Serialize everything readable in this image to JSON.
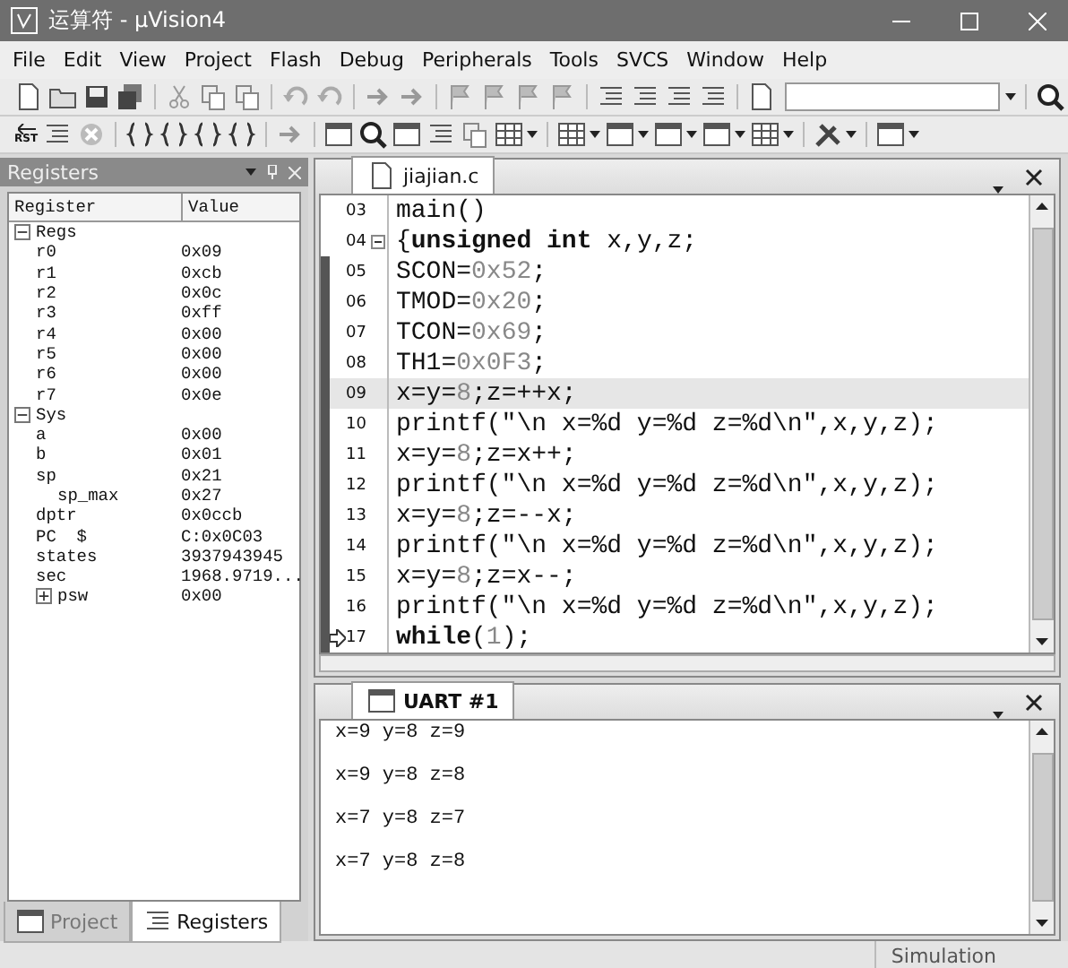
{
  "window": {
    "title": "运算符 - μVision4"
  },
  "menu": [
    "File",
    "Edit",
    "View",
    "Project",
    "Flash",
    "Debug",
    "Peripherals",
    "Tools",
    "SVCS",
    "Window",
    "Help"
  ],
  "debug_toolbar": {
    "reset_label": "RST"
  },
  "registers_panel": {
    "title": "Registers",
    "columns": [
      "Register",
      "Value"
    ],
    "tree": [
      {
        "name": "Regs",
        "expanded": true,
        "children": [
          {
            "name": "r0",
            "value": "0x09"
          },
          {
            "name": "r1",
            "value": "0xcb"
          },
          {
            "name": "r2",
            "value": "0x0c"
          },
          {
            "name": "r3",
            "value": "0xff"
          },
          {
            "name": "r4",
            "value": "0x00"
          },
          {
            "name": "r5",
            "value": "0x00"
          },
          {
            "name": "r6",
            "value": "0x00"
          },
          {
            "name": "r7",
            "value": "0x0e"
          }
        ]
      },
      {
        "name": "Sys",
        "expanded": true,
        "children": [
          {
            "name": "a",
            "value": "0x00"
          },
          {
            "name": "b",
            "value": "0x01"
          },
          {
            "name": "sp",
            "value": "0x21",
            "children": [
              {
                "name": "sp_max",
                "value": "0x27"
              }
            ]
          },
          {
            "name": "dptr",
            "value": "0x0ccb"
          },
          {
            "name": "PC  $",
            "value": "C:0x0C03"
          },
          {
            "name": "states",
            "value": "3937943945"
          },
          {
            "name": "sec",
            "value": "1968.9719..."
          },
          {
            "name": "psw",
            "value": "0x00",
            "expanded": false
          }
        ]
      }
    ],
    "tabs": [
      {
        "label": "Project",
        "selected": false
      },
      {
        "label": "Registers",
        "selected": true
      }
    ]
  },
  "editor": {
    "tab": "jiajian.c",
    "lines": [
      {
        "number": "03",
        "fold": false,
        "marked": false,
        "current": false,
        "pc": false,
        "segments": [
          {
            "text": "main()",
            "kind": "text"
          }
        ]
      },
      {
        "number": "04",
        "fold": true,
        "marked": false,
        "current": false,
        "pc": false,
        "segments": [
          {
            "text": "{",
            "kind": "text"
          },
          {
            "text": "unsigned int",
            "kind": "keyword"
          },
          {
            "text": " x,y,z;",
            "kind": "text"
          }
        ]
      },
      {
        "number": "05",
        "fold": false,
        "marked": true,
        "current": false,
        "pc": false,
        "segments": [
          {
            "text": "SCON=",
            "kind": "text"
          },
          {
            "text": "0x52",
            "kind": "number"
          },
          {
            "text": ";",
            "kind": "text"
          }
        ]
      },
      {
        "number": "06",
        "fold": false,
        "marked": true,
        "current": false,
        "pc": false,
        "segments": [
          {
            "text": "TMOD=",
            "kind": "text"
          },
          {
            "text": "0x20",
            "kind": "number"
          },
          {
            "text": ";",
            "kind": "text"
          }
        ]
      },
      {
        "number": "07",
        "fold": false,
        "marked": true,
        "current": false,
        "pc": false,
        "segments": [
          {
            "text": "TCON=",
            "kind": "text"
          },
          {
            "text": "0x69",
            "kind": "number"
          },
          {
            "text": ";",
            "kind": "text"
          }
        ]
      },
      {
        "number": "08",
        "fold": false,
        "marked": true,
        "current": false,
        "pc": false,
        "segments": [
          {
            "text": "TH1=",
            "kind": "text"
          },
          {
            "text": "0x0F3",
            "kind": "number"
          },
          {
            "text": ";",
            "kind": "text"
          }
        ]
      },
      {
        "number": "09",
        "fold": false,
        "marked": true,
        "current": true,
        "pc": false,
        "segments": [
          {
            "text": "x=y=",
            "kind": "text"
          },
          {
            "text": "8",
            "kind": "number"
          },
          {
            "text": ";z=++x;",
            "kind": "text"
          }
        ]
      },
      {
        "number": "10",
        "fold": false,
        "marked": true,
        "current": false,
        "pc": false,
        "segments": [
          {
            "text": "printf(\"\\n x=%d y=%d z=%d\\n\",x,y,z);",
            "kind": "text"
          }
        ]
      },
      {
        "number": "11",
        "fold": false,
        "marked": true,
        "current": false,
        "pc": false,
        "segments": [
          {
            "text": "x=y=",
            "kind": "text"
          },
          {
            "text": "8",
            "kind": "number"
          },
          {
            "text": ";z=x++;",
            "kind": "text"
          }
        ]
      },
      {
        "number": "12",
        "fold": false,
        "marked": true,
        "current": false,
        "pc": false,
        "segments": [
          {
            "text": "printf(\"\\n x=%d y=%d z=%d\\n\",x,y,z);",
            "kind": "text"
          }
        ]
      },
      {
        "number": "13",
        "fold": false,
        "marked": true,
        "current": false,
        "pc": false,
        "segments": [
          {
            "text": "x=y=",
            "kind": "text"
          },
          {
            "text": "8",
            "kind": "number"
          },
          {
            "text": ";z=--x;",
            "kind": "text"
          }
        ]
      },
      {
        "number": "14",
        "fold": false,
        "marked": true,
        "current": false,
        "pc": false,
        "segments": [
          {
            "text": "printf(\"\\n x=%d y=%d z=%d\\n\",x,y,z);",
            "kind": "text"
          }
        ]
      },
      {
        "number": "15",
        "fold": false,
        "marked": true,
        "current": false,
        "pc": false,
        "segments": [
          {
            "text": "x=y=",
            "kind": "text"
          },
          {
            "text": "8",
            "kind": "number"
          },
          {
            "text": ";z=x--;",
            "kind": "text"
          }
        ]
      },
      {
        "number": "16",
        "fold": false,
        "marked": true,
        "current": false,
        "pc": false,
        "segments": [
          {
            "text": "printf(\"\\n x=%d y=%d z=%d\\n\",x,y,z);",
            "kind": "text"
          }
        ]
      },
      {
        "number": "17",
        "fold": false,
        "marked": true,
        "current": false,
        "pc": true,
        "segments": [
          {
            "text": "while",
            "kind": "keyword"
          },
          {
            "text": "(",
            "kind": "text"
          },
          {
            "text": "1",
            "kind": "number"
          },
          {
            "text": ");",
            "kind": "text"
          }
        ]
      }
    ]
  },
  "uart": {
    "tab": "UART #1",
    "lines": [
      "x=9 y=8 z=9",
      "x=9 y=8 z=8",
      "x=7 y=8 z=7",
      "x=7 y=8 z=8"
    ]
  },
  "status_bar": {
    "mode": "Simulation"
  }
}
